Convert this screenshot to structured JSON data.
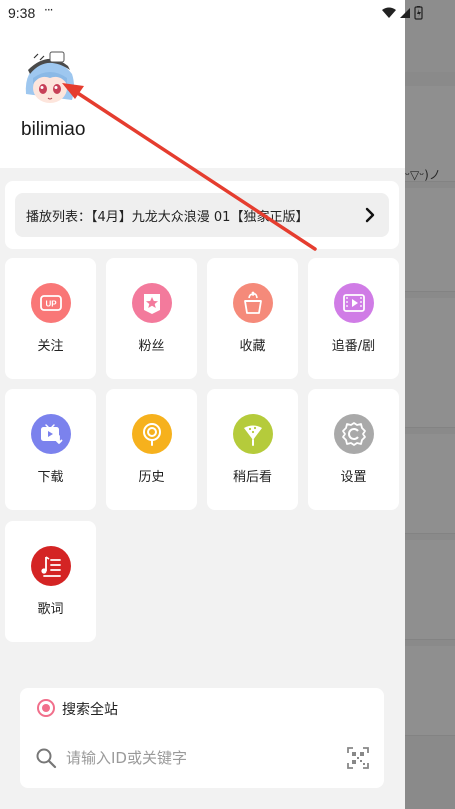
{
  "status_bar": {
    "time": "9:38",
    "dots": "···"
  },
  "background": {
    "snippet": "ᵕ▽ᵕ)ノ"
  },
  "drawer": {
    "username": "bilimiao",
    "playlist": {
      "text": "播放列表：【4月】九龙大众浪漫 01【独家正版】"
    },
    "tiles": [
      {
        "label": "关注",
        "icon": "up-badge-icon",
        "color": "#f97777"
      },
      {
        "label": "粉丝",
        "icon": "fan-badge-icon",
        "color": "#f37a9c"
      },
      {
        "label": "收藏",
        "icon": "favorite-box-icon",
        "color": "#f58a7a"
      },
      {
        "label": "追番/剧",
        "icon": "video-play-icon",
        "color": "#d07ce6"
      },
      {
        "label": "下载",
        "icon": "download-tv-icon",
        "color": "#7b82ed"
      },
      {
        "label": "历史",
        "icon": "history-icon",
        "color": "#f6b11d"
      },
      {
        "label": "稍后看",
        "icon": "watch-later-icon",
        "color": "#b5cb3b"
      },
      {
        "label": "设置",
        "icon": "gear-icon",
        "color": "#a9a9a9"
      },
      {
        "label": "歌词",
        "icon": "lyrics-icon",
        "color": "#d42424"
      }
    ],
    "search": {
      "scope_label": "搜索全站",
      "placeholder": "请输入ID或关键字"
    }
  },
  "colors": {
    "accent": "#f16f8b",
    "annotation_arrow": "#e53d2f"
  }
}
